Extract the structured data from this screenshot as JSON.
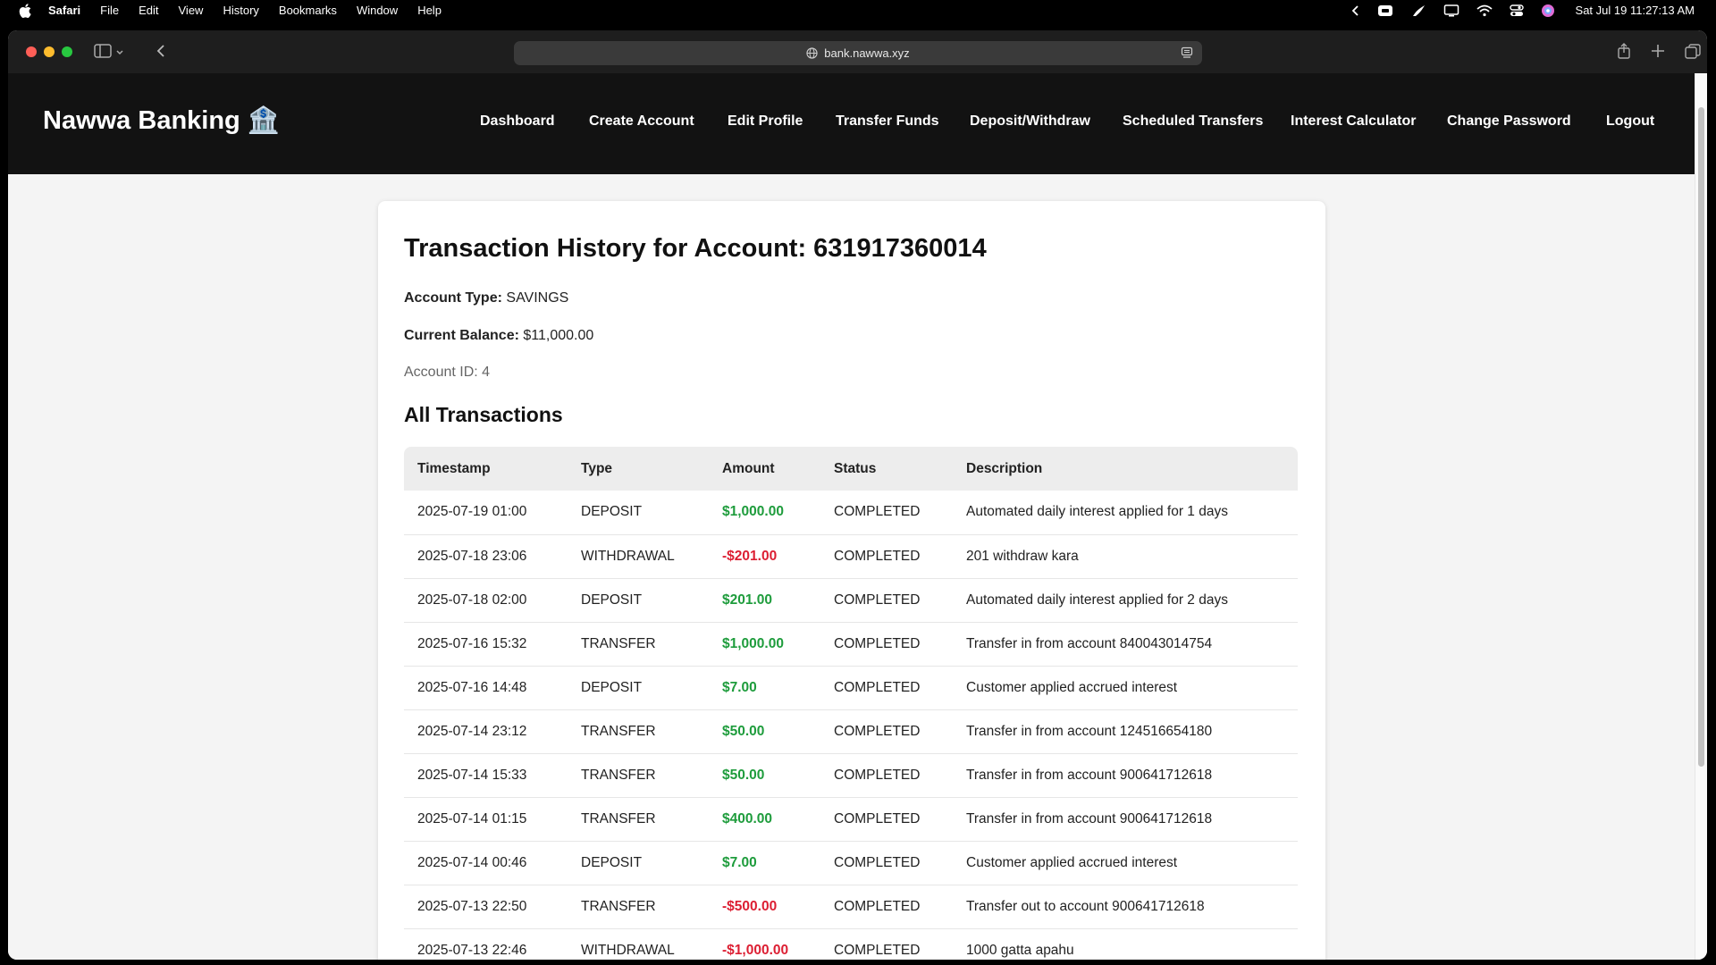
{
  "menubar": {
    "app_name": "Safari",
    "items": [
      "File",
      "Edit",
      "View",
      "History",
      "Bookmarks",
      "Window",
      "Help"
    ],
    "datetime": "Sat Jul 19  11:27:13 AM"
  },
  "browser": {
    "url": "bank.nawwa.xyz"
  },
  "site": {
    "brand": "Nawwa Banking 🏦",
    "nav": [
      "Dashboard",
      "Create Account",
      "Edit Profile",
      "Transfer Funds",
      "Deposit/Withdraw",
      "Scheduled Transfers",
      "Interest Calculator",
      "Change Password",
      "Logout"
    ]
  },
  "page": {
    "title": "Transaction History for Account: 631917360014",
    "account_type_label": "Account Type:",
    "account_type": "SAVINGS",
    "balance_label": "Current Balance:",
    "balance": "$11,000.00",
    "account_id": "Account ID: 4",
    "section_title": "All Transactions"
  },
  "table": {
    "headers": [
      "Timestamp",
      "Type",
      "Amount",
      "Status",
      "Description"
    ],
    "rows": [
      {
        "timestamp": "2025-07-19 01:00",
        "type": "DEPOSIT",
        "amount": "$1,000.00",
        "status": "COMPLETED",
        "description": "Automated daily interest applied for 1 days"
      },
      {
        "timestamp": "2025-07-18 23:06",
        "type": "WITHDRAWAL",
        "amount": "-$201.00",
        "status": "COMPLETED",
        "description": "201 withdraw kara"
      },
      {
        "timestamp": "2025-07-18 02:00",
        "type": "DEPOSIT",
        "amount": "$201.00",
        "status": "COMPLETED",
        "description": "Automated daily interest applied for 2 days"
      },
      {
        "timestamp": "2025-07-16 15:32",
        "type": "TRANSFER",
        "amount": "$1,000.00",
        "status": "COMPLETED",
        "description": "Transfer in from account 840043014754"
      },
      {
        "timestamp": "2025-07-16 14:48",
        "type": "DEPOSIT",
        "amount": "$7.00",
        "status": "COMPLETED",
        "description": "Customer applied accrued interest"
      },
      {
        "timestamp": "2025-07-14 23:12",
        "type": "TRANSFER",
        "amount": "$50.00",
        "status": "COMPLETED",
        "description": "Transfer in from account 124516654180"
      },
      {
        "timestamp": "2025-07-14 15:33",
        "type": "TRANSFER",
        "amount": "$50.00",
        "status": "COMPLETED",
        "description": "Transfer in from account 900641712618"
      },
      {
        "timestamp": "2025-07-14 01:15",
        "type": "TRANSFER",
        "amount": "$400.00",
        "status": "COMPLETED",
        "description": "Transfer in from account 900641712618"
      },
      {
        "timestamp": "2025-07-14 00:46",
        "type": "DEPOSIT",
        "amount": "$7.00",
        "status": "COMPLETED",
        "description": "Customer applied accrued interest"
      },
      {
        "timestamp": "2025-07-13 22:50",
        "type": "TRANSFER",
        "amount": "-$500.00",
        "status": "COMPLETED",
        "description": "Transfer out to account 900641712618"
      },
      {
        "timestamp": "2025-07-13 22:46",
        "type": "WITHDRAWAL",
        "amount": "-$1,000.00",
        "status": "COMPLETED",
        "description": "1000 gatta apahu"
      }
    ]
  },
  "colors": {
    "positive": "#1e9c3c",
    "negative": "#dc1e32",
    "header_bg": "#121212"
  }
}
